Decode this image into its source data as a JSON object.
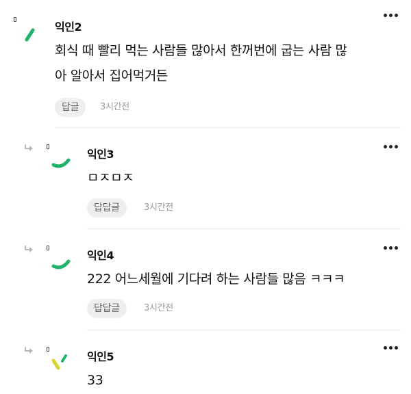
{
  "comments": [
    {
      "author": "익인2",
      "text_lines": [
        "회식 때 빨리 먹는 사람들 많아서 한꺼번에 굽는 사람 많",
        "아 알아서 집어먹거든"
      ],
      "reply_label": "답글",
      "time": "3시간전",
      "is_reply": false,
      "avatar_icon": "slash-green-icon"
    },
    {
      "author": "익인3",
      "text_lines": [
        "ㅁㅈㅁㅈ"
      ],
      "reply_label": "답답글",
      "time": "3시간전",
      "is_reply": true,
      "avatar_icon": "arc-green-icon"
    },
    {
      "author": "익인4",
      "text_lines": [
        "222 어느세월에 기다려 하는 사람들 많음 ㅋㅋㅋ"
      ],
      "reply_label": "답답글",
      "time": "3시간전",
      "is_reply": true,
      "avatar_icon": "arc-green-icon"
    },
    {
      "author": "익인5",
      "text_lines": [
        "33"
      ],
      "is_reply": true,
      "avatar_icon": "check-yellow-green-icon"
    }
  ],
  "colors": {
    "avatar_green": "#1fb36b",
    "avatar_yellow": "#d6d62b",
    "reply_bg": "#eeeeee",
    "time_gray": "#9a9a9a"
  }
}
